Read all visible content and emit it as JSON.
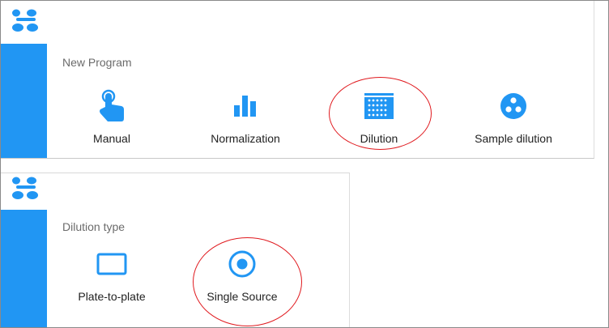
{
  "colors": {
    "brand": "#2196f3",
    "highlight_ring": "#e0191e",
    "text": "#222222",
    "muted": "#6b6b6b"
  },
  "new_program": {
    "section_label": "New Program",
    "tiles": [
      {
        "label": "Manual",
        "icon": "touch-hand-icon"
      },
      {
        "label": "Normalization",
        "icon": "bar-chart-icon"
      },
      {
        "label": "Dilution",
        "icon": "dilution-grid-icon",
        "highlighted": true
      },
      {
        "label": "Sample dilution",
        "icon": "sample-dots-circle-icon"
      }
    ]
  },
  "dilution_type": {
    "section_label": "Dilution type",
    "tiles": [
      {
        "label": "Plate-to-plate",
        "icon": "plate-rectangle-icon"
      },
      {
        "label": "Single Source",
        "icon": "single-source-radio-icon",
        "highlighted": true
      }
    ]
  }
}
